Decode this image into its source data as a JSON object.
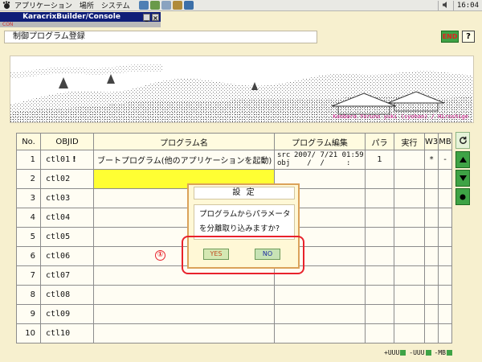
{
  "panel": {
    "menus": [
      "アプリケーション",
      "場所",
      "システム"
    ],
    "clock": "16:04"
  },
  "console": {
    "title": "KaracrixBuilder/Console",
    "strip_label": "CON"
  },
  "header": {
    "screen_title": "制御プログラム登録",
    "end_label": "END",
    "help_label": "?"
  },
  "banner": {
    "caption": "Kanbara Yoruno yuki (syohan) / Hiroshige"
  },
  "table": {
    "headers": [
      "No.",
      "OBJID",
      "プログラム名",
      "プログラム編集",
      "パラ",
      "実行",
      "W3",
      "MB"
    ],
    "rows": [
      {
        "no": "1",
        "objid": "ctl01",
        "mark": "!",
        "name": "ブートプログラム(他のアプリケーションを起動)",
        "kind": "src\nobj",
        "date": "2007/ 7/21 01:59\n   /  /     :",
        "para": "1",
        "exec": "",
        "w3": "*",
        "mb": "-"
      },
      {
        "no": "2",
        "objid": "ctl02",
        "mark": "",
        "name": "",
        "kind": "",
        "date": "",
        "para": "",
        "exec": "",
        "w3": "",
        "mb": ""
      },
      {
        "no": "3",
        "objid": "ctl03",
        "mark": "",
        "name": "",
        "kind": "",
        "date": "",
        "para": "",
        "exec": "",
        "w3": "",
        "mb": ""
      },
      {
        "no": "4",
        "objid": "ctl04",
        "mark": "",
        "name": "",
        "kind": "",
        "date": "",
        "para": "",
        "exec": "",
        "w3": "",
        "mb": ""
      },
      {
        "no": "5",
        "objid": "ctl05",
        "mark": "",
        "name": "",
        "kind": "",
        "date": "",
        "para": "",
        "exec": "",
        "w3": "",
        "mb": ""
      },
      {
        "no": "6",
        "objid": "ctl06",
        "mark": "",
        "name": "",
        "kind": "",
        "date": "",
        "para": "",
        "exec": "",
        "w3": "",
        "mb": ""
      },
      {
        "no": "7",
        "objid": "ctl07",
        "mark": "",
        "name": "",
        "kind": "",
        "date": "",
        "para": "",
        "exec": "",
        "w3": "",
        "mb": ""
      },
      {
        "no": "8",
        "objid": "ctl08",
        "mark": "",
        "name": "",
        "kind": "",
        "date": "",
        "para": "",
        "exec": "",
        "w3": "",
        "mb": ""
      },
      {
        "no": "9",
        "objid": "ctl09",
        "mark": "",
        "name": "",
        "kind": "",
        "date": "",
        "para": "",
        "exec": "",
        "w3": "",
        "mb": ""
      },
      {
        "no": "10",
        "objid": "ctl10",
        "mark": "",
        "name": "",
        "kind": "",
        "date": "",
        "para": "",
        "exec": "",
        "w3": "",
        "mb": ""
      }
    ],
    "selected_row": 2
  },
  "side_controls": [
    "refresh-icon",
    "arrow-up-icon",
    "arrow-down-icon",
    "dot-icon"
  ],
  "footer": {
    "buttons": [
      "+UUU",
      "-UUU",
      "-MB"
    ]
  },
  "dialog": {
    "title": "設 定",
    "message_line1": "プログラムからパラメータ",
    "message_line2": "を分離取り込みますか?",
    "yes_label": "YES",
    "no_label": "NO"
  },
  "annotation": {
    "number": "①",
    "color": "#e8222c"
  },
  "colors": {
    "background": "#f7f0cf",
    "accent_green": "#3ea345",
    "selected_row": "#ffff33",
    "titlebar": "#0f1e78"
  }
}
